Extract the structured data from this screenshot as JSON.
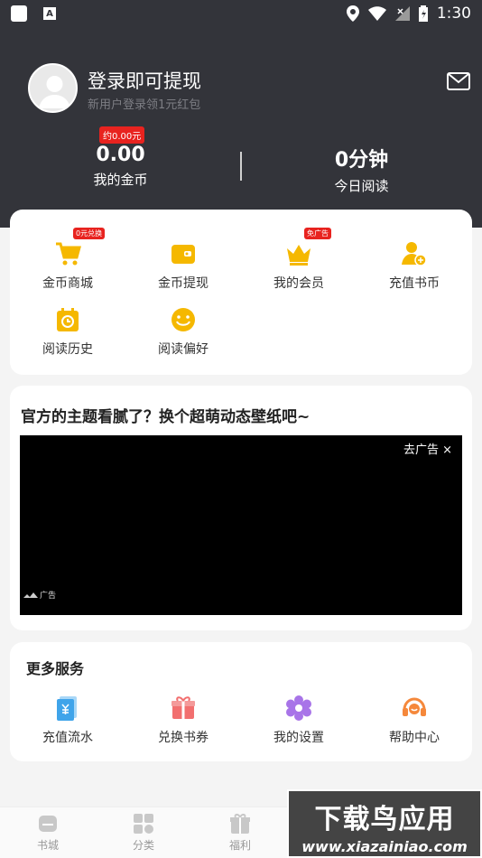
{
  "status_bar": {
    "time": "1:30",
    "notification_icon_label": "A"
  },
  "header": {
    "login_title": "登录即可提现",
    "login_subtitle": "新用户登录领1元红包",
    "coin_badge": "约0.00元",
    "coins": {
      "value": "0.00",
      "label": "我的金币"
    },
    "reading": {
      "value": "0分钟",
      "label": "今日阅读"
    }
  },
  "quick_actions": [
    {
      "label": "金币商城",
      "icon": "cart-icon",
      "badge": "0元兑换"
    },
    {
      "label": "金币提现",
      "icon": "wallet-icon",
      "badge": ""
    },
    {
      "label": "我的会员",
      "icon": "crown-icon",
      "badge": "免广告"
    },
    {
      "label": "充值书币",
      "icon": "user-coin-icon",
      "badge": ""
    },
    {
      "label": "阅读历史",
      "icon": "history-icon",
      "badge": ""
    },
    {
      "label": "阅读偏好",
      "icon": "smile-icon",
      "badge": ""
    }
  ],
  "promo": {
    "title": "官方的主题看腻了？换个超萌动态壁纸吧~",
    "ad_close": "去广告 ×",
    "ad_mark": "广告"
  },
  "services": {
    "title": "更多服务",
    "items": [
      {
        "label": "充值流水",
        "icon": "recharge-record-icon"
      },
      {
        "label": "兑换书券",
        "icon": "gift-voucher-icon"
      },
      {
        "label": "我的设置",
        "icon": "settings-icon"
      },
      {
        "label": "帮助中心",
        "icon": "headset-icon"
      }
    ]
  },
  "tabbar": {
    "tabs": [
      {
        "label": "书城",
        "icon": "bookstore-icon"
      },
      {
        "label": "分类",
        "icon": "category-icon"
      },
      {
        "label": "福利",
        "icon": "gift-icon"
      }
    ]
  },
  "watermark": {
    "big": "下载鸟应用",
    "url": "www.xiazainiao.com"
  },
  "colors": {
    "header_bg": "#33343a",
    "accent": "#f5b800",
    "badge": "#e8231f"
  }
}
